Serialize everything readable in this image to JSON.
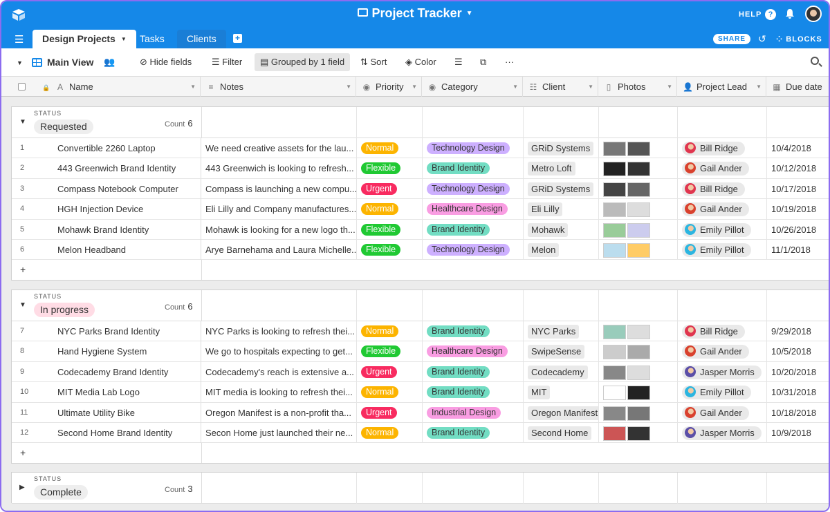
{
  "app": {
    "title": "Project Tracker",
    "help_label": "HELP",
    "help_icon": "?",
    "share_label": "SHARE",
    "blocks_label": "BLOCKS",
    "bell_icon": "bell-icon"
  },
  "tabs": [
    {
      "label": "Design Projects"
    },
    {
      "label": "Tasks"
    },
    {
      "label": "Clients"
    }
  ],
  "toolbar": {
    "view_name": "Main View",
    "hide_fields": "Hide fields",
    "filter": "Filter",
    "grouped": "Grouped by 1 field",
    "sort": "Sort",
    "color": "Color",
    "more": "···"
  },
  "columns": {
    "name": "Name",
    "notes": "Notes",
    "priority": "Priority",
    "category": "Category",
    "client": "Client",
    "photos": "Photos",
    "lead": "Project Lead",
    "due": "Due date"
  },
  "groups": [
    {
      "label": "STATUS",
      "name": "Requested",
      "count_label": "Count",
      "count": "6",
      "rows": [
        {
          "n": "1",
          "name": "Convertible 2260 Laptop",
          "notes": "We need creative assets for the lau...",
          "priority": "Normal",
          "category": "Technology Design",
          "client": "GRiD Systems",
          "lead": "Bill Ridge",
          "due": "10/4/2018"
        },
        {
          "n": "2",
          "name": "443 Greenwich Brand Identity",
          "notes": "443 Greenwich is looking to refresh...",
          "priority": "Flexible",
          "category": "Brand Identity",
          "client": "Metro Loft",
          "lead": "Gail Ander",
          "due": "10/12/2018"
        },
        {
          "n": "3",
          "name": "Compass Notebook Computer",
          "notes": "Compass is launching a new compu...",
          "priority": "Urgent",
          "category": "Technology Design",
          "client": "GRiD Systems",
          "lead": "Bill Ridge",
          "due": "10/17/2018"
        },
        {
          "n": "4",
          "name": "HGH Injection Device",
          "notes": "Eli Lilly and Company manufactures...",
          "priority": "Normal",
          "category": "Healthcare Design",
          "client": "Eli Lilly",
          "lead": "Gail Ander",
          "due": "10/19/2018"
        },
        {
          "n": "5",
          "name": "Mohawk Brand Identity",
          "notes": "Mohawk is looking for a new logo th...",
          "priority": "Flexible",
          "category": "Brand Identity",
          "client": "Mohawk",
          "lead": "Emily Pillot",
          "due": "10/26/2018"
        },
        {
          "n": "6",
          "name": "Melon Headband",
          "notes": "Arye Barnehama and Laura Michelle...",
          "priority": "Flexible",
          "category": "Technology Design",
          "client": "Melon",
          "lead": "Emily Pillot",
          "due": "11/1/2018"
        }
      ]
    },
    {
      "label": "STATUS",
      "name": "In progress",
      "count_label": "Count",
      "count": "6",
      "rows": [
        {
          "n": "7",
          "name": "NYC Parks Brand Identity",
          "notes": "NYC Parks is looking to refresh thei...",
          "priority": "Normal",
          "category": "Brand Identity",
          "client": "NYC Parks",
          "lead": "Bill Ridge",
          "due": "9/29/2018"
        },
        {
          "n": "8",
          "name": "Hand Hygiene System",
          "notes": "We go to hospitals expecting to get...",
          "priority": "Flexible",
          "category": "Healthcare Design",
          "client": "SwipeSense",
          "lead": "Gail Ander",
          "due": "10/5/2018"
        },
        {
          "n": "9",
          "name": "Codecademy Brand Identity",
          "notes": "Codecademy's reach is extensive a...",
          "priority": "Urgent",
          "category": "Brand Identity",
          "client": "Codecademy",
          "lead": "Jasper Morris",
          "due": "10/20/2018"
        },
        {
          "n": "10",
          "name": "MIT Media Lab Logo",
          "notes": "MIT media is looking to refresh thei...",
          "priority": "Normal",
          "category": "Brand Identity",
          "client": "MIT",
          "lead": "Emily Pillot",
          "due": "10/31/2018"
        },
        {
          "n": "11",
          "name": "Ultimate Utility Bike",
          "notes": "Oregon Manifest is a non-profit tha...",
          "priority": "Urgent",
          "category": "Industrial Design",
          "client": "Oregon Manifest",
          "lead": "Gail Ander",
          "due": "10/18/2018"
        },
        {
          "n": "12",
          "name": "Second Home Brand Identity",
          "notes": "Secon Home just launched their ne...",
          "priority": "Normal",
          "category": "Brand Identity",
          "client": "Second Home",
          "lead": "Jasper Morris",
          "due": "10/9/2018"
        }
      ]
    },
    {
      "label": "STATUS",
      "name": "Complete",
      "count_label": "Count",
      "count": "3",
      "rows": []
    }
  ],
  "colors": {
    "accent": "#1588e8",
    "Normal": "#fcb400",
    "Flexible": "#20c933",
    "Urgent": "#f82b60",
    "Brand Identity": "#72ddc3",
    "Technology Design": "#cdb0ff",
    "Healthcare Design": "#f99de2",
    "Industrial Design": "#f99de2",
    "Requested": "#eeeeee",
    "In progress": "#ffdce5",
    "Complete": "#eeeeee"
  },
  "leads": {
    "Bill Ridge": "#e0364f",
    "Gail Ander": "#d9412e",
    "Emily Pillot": "#2bb5e0",
    "Jasper Morris": "#5b4fa8"
  }
}
